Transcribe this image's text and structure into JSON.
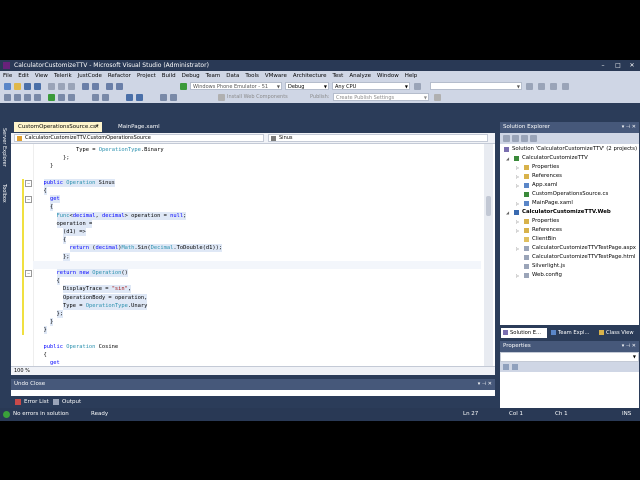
{
  "window": {
    "title": "CalculatorCustomizeTTV - Microsoft Visual Studio (Administrator)",
    "min": "–",
    "max": "□",
    "close": "✕"
  },
  "menu": [
    "File",
    "Edit",
    "View",
    "Telerik",
    "JustCode",
    "Refactor",
    "Project",
    "Build",
    "Debug",
    "Team",
    "Data",
    "Tools",
    "VMware",
    "Architecture",
    "Test",
    "Analyze",
    "Window",
    "Help"
  ],
  "toolbar": {
    "target": "Windows Phone Emulator - 51",
    "config": "Debug",
    "platform": "Any CPU",
    "install": "Install Web Components",
    "publish": "Publish:",
    "publish_settings": "Create Publish Settings"
  },
  "side_tabs": {
    "server_explorer": "Server Explorer",
    "toolbox": "Toolbox"
  },
  "doc_tabs": {
    "active": "CustomOperationsSource.cs*",
    "active_close": "✕",
    "other": "MainPage.xaml"
  },
  "navbar": {
    "type": "CalculatorCustomizeTTV.CustomOperationsSource",
    "member": "Sinus"
  },
  "code": [
    {
      "ind": 12,
      "parts": [
        [
          "",
          "Type = "
        ],
        [
          "ty",
          "OperationType"
        ],
        [
          "",
          ".Binary"
        ]
      ]
    },
    {
      "ind": 8,
      "parts": [
        [
          "",
          "};"
        ]
      ]
    },
    {
      "ind": 4,
      "parts": [
        [
          "",
          "}"
        ]
      ]
    },
    {
      "ind": 0,
      "parts": []
    },
    {
      "ind": 2,
      "parts": [
        [
          "kw",
          "public "
        ],
        [
          "ty",
          "Operation"
        ],
        [
          "",
          " Sinus"
        ]
      ],
      "sel": true
    },
    {
      "ind": 2,
      "parts": [
        [
          "",
          "{"
        ]
      ],
      "sel": true
    },
    {
      "ind": 4,
      "parts": [
        [
          "kw",
          "get"
        ]
      ],
      "sel": true
    },
    {
      "ind": 4,
      "parts": [
        [
          "",
          "{"
        ]
      ],
      "sel": true
    },
    {
      "ind": 6,
      "parts": [
        [
          "ty",
          "Func"
        ],
        [
          "",
          "<"
        ],
        [
          "kw",
          "decimal"
        ],
        [
          "",
          ", "
        ],
        [
          "kw",
          "decimal"
        ],
        [
          "",
          "> operation = "
        ],
        [
          "kw",
          "null"
        ],
        [
          "",
          ";"
        ]
      ],
      "sel": true
    },
    {
      "ind": 6,
      "parts": [
        [
          "",
          "operation ="
        ]
      ],
      "sel": true
    },
    {
      "ind": 8,
      "parts": [
        [
          "",
          "(d1) =>"
        ]
      ],
      "sel": true
    },
    {
      "ind": 8,
      "parts": [
        [
          "",
          "{"
        ]
      ],
      "sel": true
    },
    {
      "ind": 10,
      "parts": [
        [
          "kw",
          "return "
        ],
        [
          "",
          "("
        ],
        [
          "kw",
          "decimal"
        ],
        [
          "",
          ")"
        ],
        [
          "ty",
          "Math"
        ],
        [
          "",
          ".Sin("
        ],
        [
          "ty",
          "Decimal"
        ],
        [
          "",
          ".ToDouble(d1));"
        ]
      ],
      "sel": true
    },
    {
      "ind": 8,
      "parts": [
        [
          "",
          "};"
        ]
      ],
      "sel": true
    },
    {
      "ind": 0,
      "parts": [],
      "cur": true
    },
    {
      "ind": 6,
      "parts": [
        [
          "kw",
          "return new "
        ],
        [
          "ty",
          "Operation"
        ],
        [
          "",
          "()"
        ]
      ],
      "sel": true
    },
    {
      "ind": 6,
      "parts": [
        [
          "",
          "{"
        ]
      ],
      "sel": true
    },
    {
      "ind": 8,
      "parts": [
        [
          "",
          "DisplayTrace = "
        ],
        [
          "st",
          "\"sin\""
        ],
        [
          "",
          ","
        ]
      ],
      "sel": true
    },
    {
      "ind": 8,
      "parts": [
        [
          "",
          "OperationBody = operation,"
        ]
      ],
      "sel": true
    },
    {
      "ind": 8,
      "parts": [
        [
          "",
          "Type = "
        ],
        [
          "ty",
          "OperationType"
        ],
        [
          "",
          ".Unary"
        ]
      ],
      "sel": true
    },
    {
      "ind": 6,
      "parts": [
        [
          "",
          "};"
        ]
      ],
      "sel": true
    },
    {
      "ind": 4,
      "parts": [
        [
          "",
          "}"
        ]
      ],
      "sel": true
    },
    {
      "ind": 2,
      "parts": [
        [
          "",
          "}"
        ]
      ],
      "sel": true
    },
    {
      "ind": 0,
      "parts": []
    },
    {
      "ind": 2,
      "parts": [
        [
          "kw",
          "public "
        ],
        [
          "ty",
          "Operation"
        ],
        [
          "",
          " Cosine"
        ]
      ]
    },
    {
      "ind": 2,
      "parts": [
        [
          "",
          "{"
        ]
      ]
    },
    {
      "ind": 4,
      "parts": [
        [
          "kw",
          "get"
        ]
      ]
    }
  ],
  "editor": {
    "zoom": "100 %"
  },
  "undo_panel": {
    "title": "Undo Close"
  },
  "bottom_tabs": {
    "errors": "Error List",
    "output": "Output"
  },
  "status": {
    "message": "No errors in solution",
    "state": "Ready",
    "ln": "Ln 27",
    "col": "Col 1",
    "ch": "Ch 1",
    "ins": "INS"
  },
  "solution_explorer": {
    "title": "Solution Explorer",
    "nodes": [
      {
        "label": "Solution 'CalculatorCustomizeTTV' (2 projects)",
        "lvl": 0,
        "icon": "#7a6fb0"
      },
      {
        "label": "CalculatorCustomizeTTV",
        "lvl": 1,
        "icon": "#3a8a3a",
        "exp": "◢"
      },
      {
        "label": "Properties",
        "lvl": 2,
        "icon": "#d8b24a",
        "exp": "▷"
      },
      {
        "label": "References",
        "lvl": 2,
        "icon": "#d8b24a",
        "exp": "▷"
      },
      {
        "label": "App.xaml",
        "lvl": 2,
        "icon": "#5a86c8",
        "exp": "▷"
      },
      {
        "label": "CustomOperationsSource.cs",
        "lvl": 2,
        "icon": "#3a8a3a"
      },
      {
        "label": "MainPage.xaml",
        "lvl": 2,
        "icon": "#5a86c8",
        "exp": "▷"
      },
      {
        "label": "CalculatorCustomizeTTV.Web",
        "lvl": 1,
        "icon": "#3a6ab0",
        "exp": "◢",
        "bold": true
      },
      {
        "label": "Properties",
        "lvl": 2,
        "icon": "#d8b24a",
        "exp": "▷"
      },
      {
        "label": "References",
        "lvl": 2,
        "icon": "#d8b24a",
        "exp": "▷"
      },
      {
        "label": "ClientBin",
        "lvl": 2,
        "icon": "#e0c060"
      },
      {
        "label": "CalculatorCustomizeTTVTestPage.aspx",
        "lvl": 2,
        "icon": "#9aa4b8",
        "exp": "▷"
      },
      {
        "label": "CalculatorCustomizeTTVTestPage.html",
        "lvl": 2,
        "icon": "#9aa4b8"
      },
      {
        "label": "Silverlight.js",
        "lvl": 2,
        "icon": "#9aa4b8"
      },
      {
        "label": "Web.config",
        "lvl": 2,
        "icon": "#9aa4b8",
        "exp": "▷"
      }
    ],
    "tabs": {
      "solution": "Solution E...",
      "team": "Team Expl...",
      "class": "Class View"
    }
  },
  "properties": {
    "title": "Properties"
  },
  "colors": {
    "frame": "#293955",
    "chrome": "#cfd6e5",
    "panel_header": "#46587a",
    "active_tab": "#fff5cc",
    "keyword": "#0000ff",
    "type": "#2b91af",
    "string": "#a31515"
  }
}
